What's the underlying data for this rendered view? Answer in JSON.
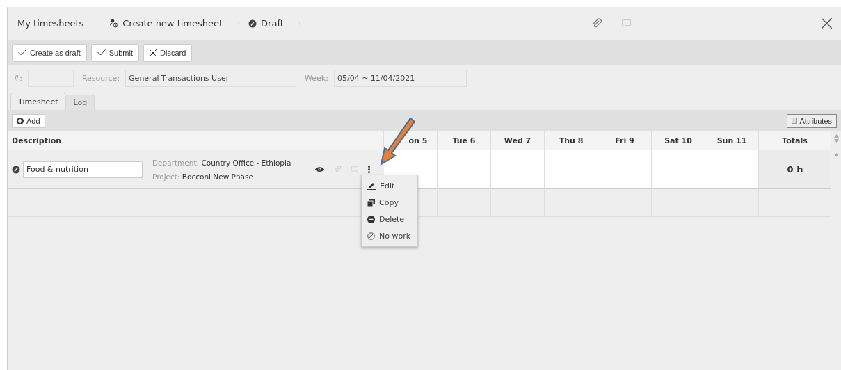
{
  "breadcrumbs": [
    {
      "label": "My timesheets"
    },
    {
      "label": "Create new timesheet"
    },
    {
      "label": "Draft"
    }
  ],
  "toolbar": [
    {
      "label": "Create as draft"
    },
    {
      "label": "Submit"
    },
    {
      "label": "Discard"
    }
  ],
  "form": {
    "number_label": "#:",
    "resource_label": "Resource:",
    "resource_value": "General Transactions User",
    "week_label": "Week:",
    "week_value": "05/04 ~ 11/04/2021"
  },
  "tabs": [
    {
      "label": "Timesheet",
      "selected": true
    },
    {
      "label": "Log",
      "selected": false
    }
  ],
  "add_button": "Add",
  "attributes_button": "Attributes",
  "table": {
    "description_header": "Description",
    "day_headers": [
      "on 5",
      "Tue 6",
      "Wed 7",
      "Thu 8",
      "Fri 9",
      "Sat 10",
      "Sun 11"
    ],
    "totals_header": "Totals",
    "rows": [
      {
        "description": "Food & nutrition",
        "department_label": "Department:",
        "department": "Country Office - Ethiopia",
        "project_label": "Project:",
        "project": "Bocconi New Phase",
        "total": "0 h"
      }
    ]
  },
  "menu": [
    {
      "label": "Edit"
    },
    {
      "label": "Copy"
    },
    {
      "label": "Delete"
    },
    {
      "label": "No work"
    }
  ]
}
